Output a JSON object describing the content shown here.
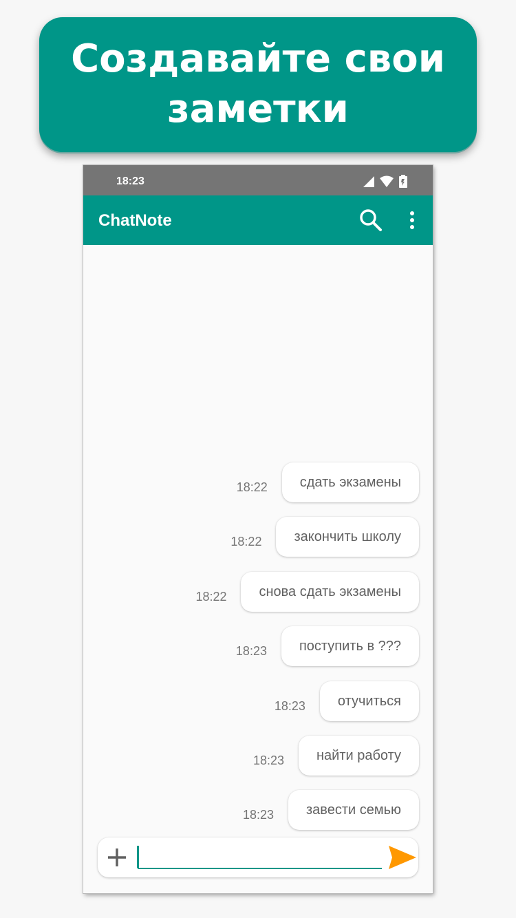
{
  "banner": {
    "line1": "Создавайте свои",
    "line2": "заметки"
  },
  "statusbar": {
    "time": "18:23",
    "icons": [
      "signal-icon",
      "wifi-icon",
      "battery-icon"
    ]
  },
  "toolbar": {
    "title": "ChatNote",
    "search_icon": "search-icon",
    "menu_icon": "more-vert-icon"
  },
  "messages": [
    {
      "time": "18:22",
      "text": "сдать экзамены"
    },
    {
      "time": "18:22",
      "text": "закончить школу"
    },
    {
      "time": "18:22",
      "text": "снова сдать экзамены"
    },
    {
      "time": "18:23",
      "text": "поступить в ???"
    },
    {
      "time": "18:23",
      "text": "отучиться"
    },
    {
      "time": "18:23",
      "text": "найти работу"
    },
    {
      "time": "18:23",
      "text": "завести семью"
    }
  ],
  "composer": {
    "value": "",
    "add_icon": "plus-icon",
    "send_icon": "send-icon"
  },
  "colors": {
    "primary": "#009688",
    "statusbar": "#757575",
    "send": "#ff9800",
    "background": "#fafafa"
  }
}
